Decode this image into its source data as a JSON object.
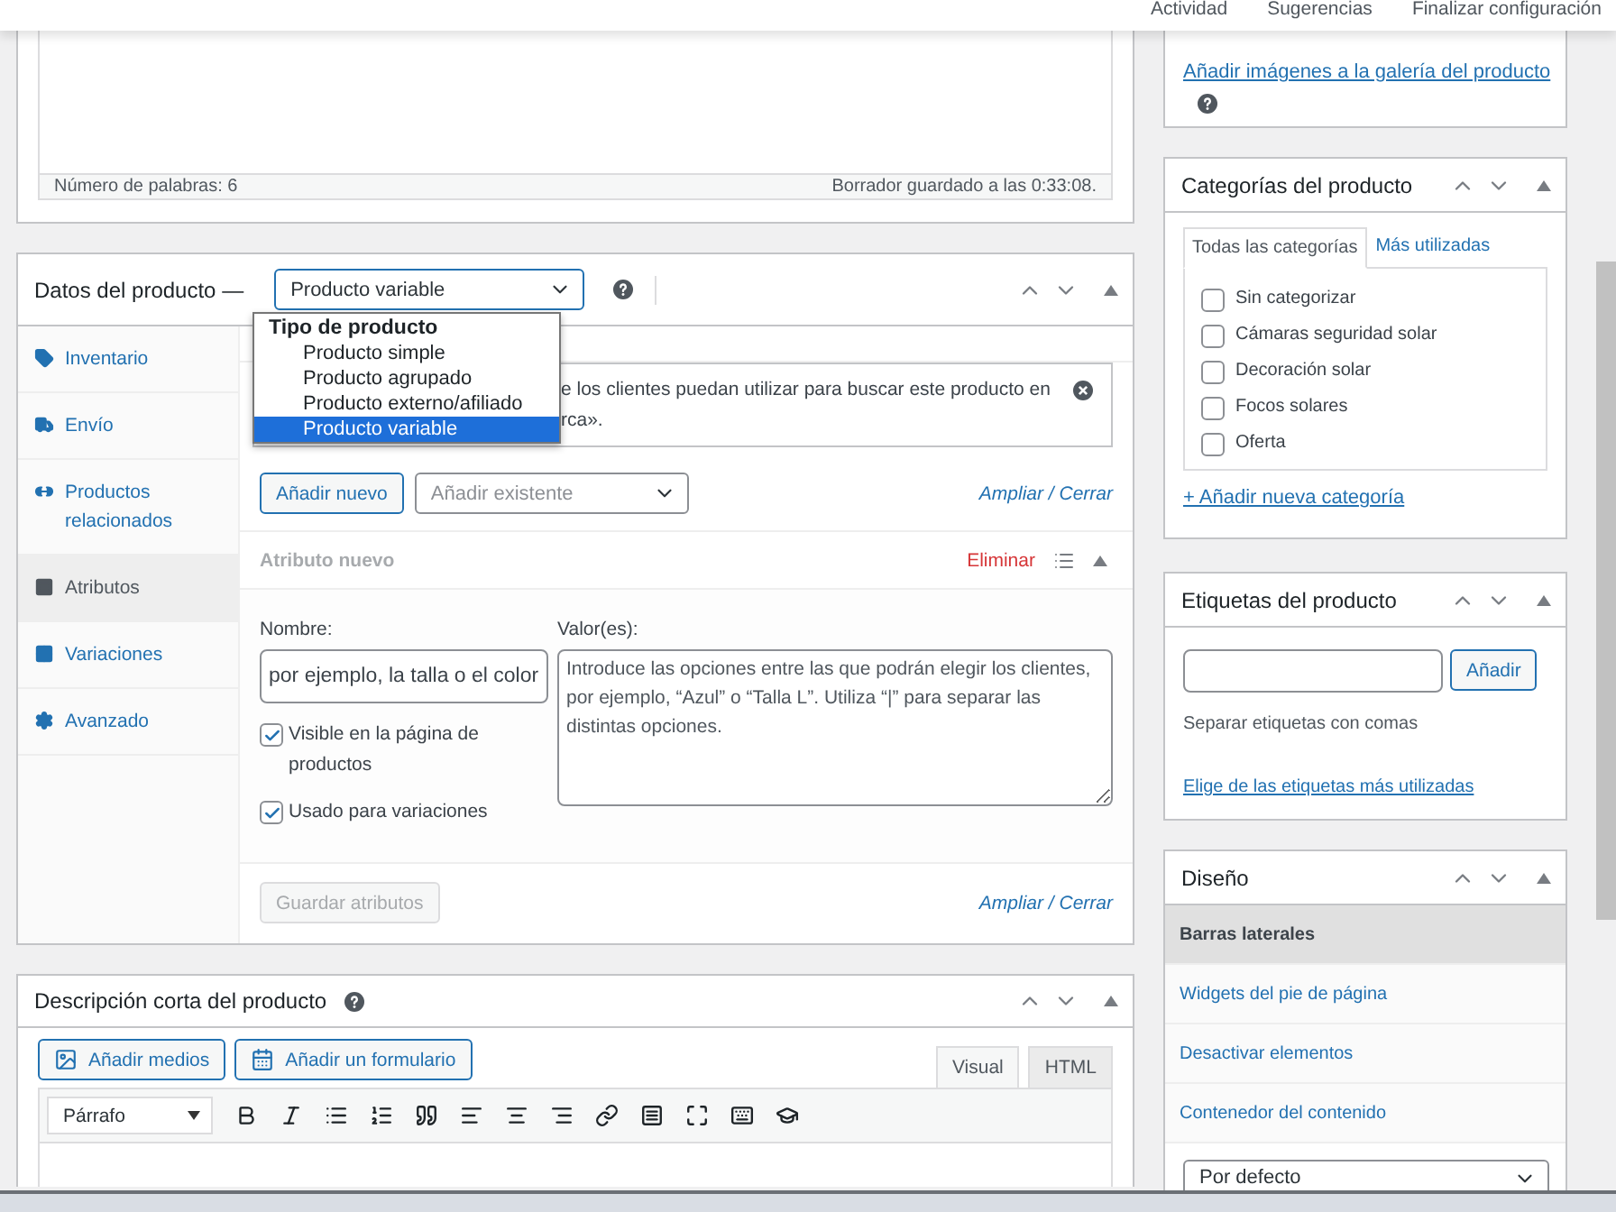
{
  "top_bar": {
    "links": [
      "Actividad",
      "Sugerencias",
      "Finalizar configuración"
    ]
  },
  "editor": {
    "word_count": "Número de palabras: 6",
    "draft_status": "Borrador guardado a las 0:33:08."
  },
  "product_data": {
    "title": "Datos del producto —",
    "type_select": {
      "value": "Producto variable",
      "expanded": true,
      "group_label": "Tipo de producto",
      "options": [
        {
          "label": "Producto simple",
          "selected": false
        },
        {
          "label": "Producto agrupado",
          "selected": false
        },
        {
          "label": "Producto externo/afiliado",
          "selected": false
        },
        {
          "label": "Producto variable",
          "selected": true
        }
      ]
    },
    "tabs": [
      {
        "label": "Inventario",
        "selected": false
      },
      {
        "label": "Envío",
        "selected": false
      },
      {
        "label": "Productos relacionados",
        "selected": false
      },
      {
        "label": "Atributos",
        "selected": true
      },
      {
        "label": "Variaciones",
        "selected": false
      },
      {
        "label": "Avanzado",
        "selected": false
      }
    ],
    "notice_lines": [
      "e los clientes puedan utilizar para buscar este producto en",
      "rca»."
    ],
    "add_new_button": "Añadir nuevo",
    "add_existing": {
      "placeholder": "Añadir existente"
    },
    "expand_collapse_top": "Ampliar / Cerrar",
    "attribute": {
      "title": "Atributo nuevo",
      "remove": "Eliminar",
      "name_label": "Nombre:",
      "name_placeholder": "por ejemplo, la talla o el color",
      "values_label": "Valor(es):",
      "values_placeholder": "Introduce las opciones entre las que podrán elegir los clientes, por ejemplo, “Azul” o “Talla L”. Utiliza “|” para separar las distintas opciones.",
      "options": [
        {
          "label": "Visible en la página de productos",
          "checked": true
        },
        {
          "label": "Usado para variaciones",
          "checked": true
        }
      ]
    },
    "save_button": {
      "label": "Guardar atributos",
      "disabled": true
    },
    "expand_collapse_bottom": "Ampliar / Cerrar"
  },
  "short_description": {
    "title": "Descripción corta del producto",
    "buttons": [
      "Añadir medios",
      "Añadir un formulario"
    ],
    "tabs": [
      {
        "label": "Visual",
        "selected": true
      },
      {
        "label": "HTML",
        "selected": false
      }
    ],
    "format_select": "Párrafo"
  },
  "gallery": {
    "link": "Añadir imágenes a la galería del producto"
  },
  "categories": {
    "title": "Categorías del producto",
    "tabs": [
      {
        "label": "Todas las categorías",
        "selected": true
      },
      {
        "label": "Más utilizadas",
        "selected": false
      }
    ],
    "items": [
      {
        "label": "Sin categorizar",
        "checked": false
      },
      {
        "label": "Cámaras seguridad solar",
        "checked": false
      },
      {
        "label": "Decoración solar",
        "checked": false
      },
      {
        "label": "Focos solares",
        "checked": false
      },
      {
        "label": "Oferta",
        "checked": false
      }
    ],
    "add_link": "+ Añadir nueva categoría"
  },
  "tags": {
    "title": "Etiquetas del producto",
    "add_button": "Añadir",
    "hint": "Separar etiquetas con comas",
    "link": "Elige de las etiquetas más utilizadas"
  },
  "design": {
    "title": "Diseño",
    "items": [
      {
        "label": "Barras laterales",
        "selected": true
      },
      {
        "label": "Widgets del pie de página",
        "selected": false
      },
      {
        "label": "Desactivar elementos",
        "selected": false
      },
      {
        "label": "Contenedor del contenido",
        "selected": false
      }
    ],
    "select_value": "Por defecto"
  }
}
